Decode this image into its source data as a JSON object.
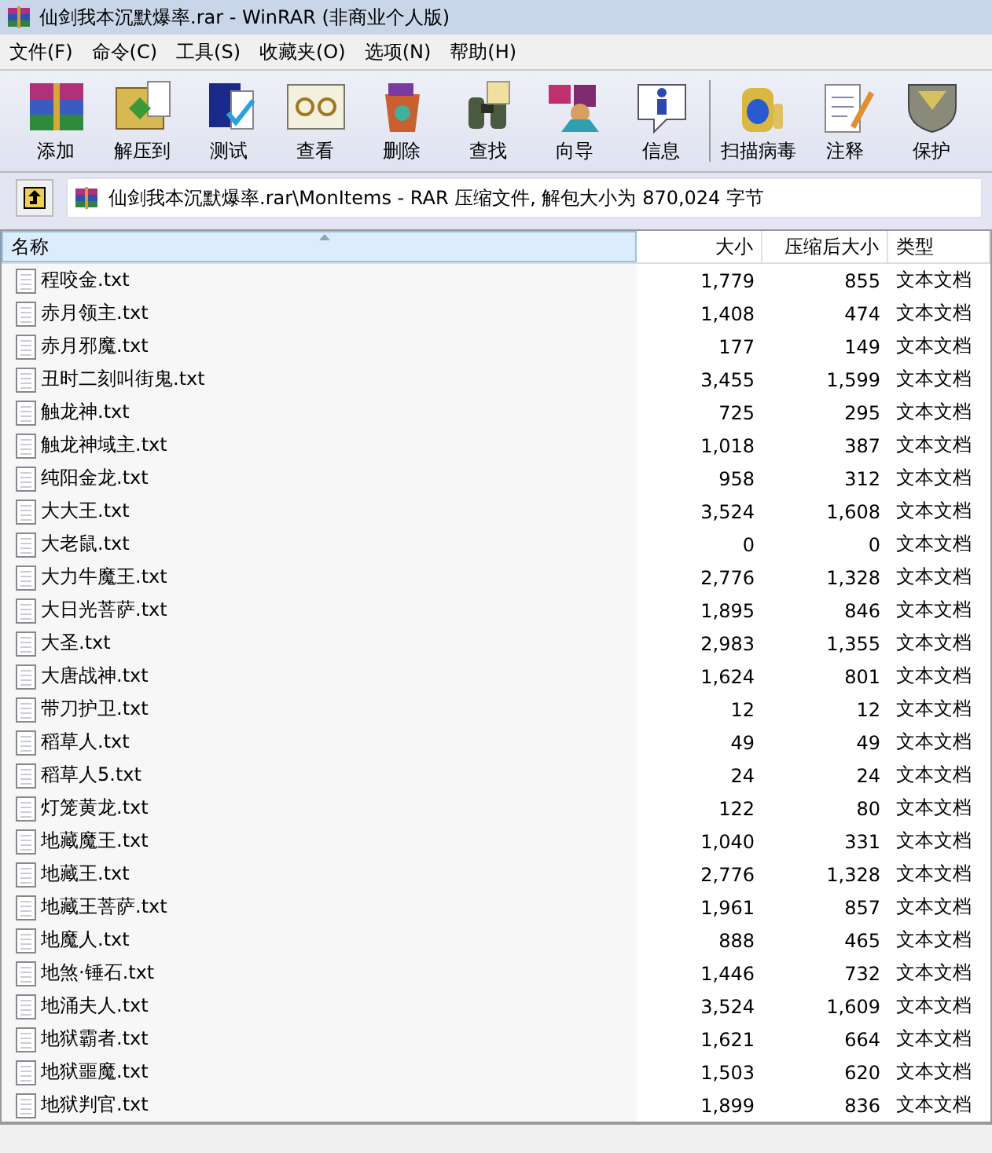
{
  "window": {
    "title": "仙剑我本沉默爆率.rar - WinRAR (非商业个人版)"
  },
  "menu": [
    "文件(F)",
    "命令(C)",
    "工具(S)",
    "收藏夹(O)",
    "选项(N)",
    "帮助(H)"
  ],
  "toolbar": [
    {
      "label": "添加",
      "separator_before": false
    },
    {
      "label": "解压到",
      "separator_before": false
    },
    {
      "label": "测试",
      "separator_before": false
    },
    {
      "label": "查看",
      "separator_before": false
    },
    {
      "label": "删除",
      "separator_before": false
    },
    {
      "label": "查找",
      "separator_before": false
    },
    {
      "label": "向导",
      "separator_before": false
    },
    {
      "label": "信息",
      "separator_before": false
    },
    {
      "label": "扫描病毒",
      "separator_before": true
    },
    {
      "label": "注释",
      "separator_before": false
    },
    {
      "label": "保护",
      "separator_before": false
    }
  ],
  "address": "仙剑我本沉默爆率.rar\\MonItems - RAR 压缩文件, 解包大小为 870,024 字节",
  "table": {
    "columns": [
      {
        "label": "名称",
        "sorted": true
      },
      {
        "label": "大小",
        "sorted": false
      },
      {
        "label": "压缩后大小",
        "sorted": false
      },
      {
        "label": "类型",
        "sorted": false
      }
    ],
    "rows": [
      [
        "程咬金.txt",
        "1,779",
        "855",
        "文本文档"
      ],
      [
        "赤月领主.txt",
        "1,408",
        "474",
        "文本文档"
      ],
      [
        "赤月邪魔.txt",
        "177",
        "149",
        "文本文档"
      ],
      [
        "丑时二刻叫街鬼.txt",
        "3,455",
        "1,599",
        "文本文档"
      ],
      [
        "触龙神.txt",
        "725",
        "295",
        "文本文档"
      ],
      [
        "触龙神域主.txt",
        "1,018",
        "387",
        "文本文档"
      ],
      [
        "纯阳金龙.txt",
        "958",
        "312",
        "文本文档"
      ],
      [
        "大大王.txt",
        "3,524",
        "1,608",
        "文本文档"
      ],
      [
        "大老鼠.txt",
        "0",
        "0",
        "文本文档"
      ],
      [
        "大力牛魔王.txt",
        "2,776",
        "1,328",
        "文本文档"
      ],
      [
        "大日光菩萨.txt",
        "1,895",
        "846",
        "文本文档"
      ],
      [
        "大圣.txt",
        "2,983",
        "1,355",
        "文本文档"
      ],
      [
        "大唐战神.txt",
        "1,624",
        "801",
        "文本文档"
      ],
      [
        "带刀护卫.txt",
        "12",
        "12",
        "文本文档"
      ],
      [
        "稻草人.txt",
        "49",
        "49",
        "文本文档"
      ],
      [
        "稻草人5.txt",
        "24",
        "24",
        "文本文档"
      ],
      [
        "灯笼黄龙.txt",
        "122",
        "80",
        "文本文档"
      ],
      [
        "地藏魔王.txt",
        "1,040",
        "331",
        "文本文档"
      ],
      [
        "地藏王.txt",
        "2,776",
        "1,328",
        "文本文档"
      ],
      [
        "地藏王菩萨.txt",
        "1,961",
        "857",
        "文本文档"
      ],
      [
        "地魔人.txt",
        "888",
        "465",
        "文本文档"
      ],
      [
        "地煞·锤石.txt",
        "1,446",
        "732",
        "文本文档"
      ],
      [
        "地涌夫人.txt",
        "3,524",
        "1,609",
        "文本文档"
      ],
      [
        "地狱霸者.txt",
        "1,621",
        "664",
        "文本文档"
      ],
      [
        "地狱噩魔.txt",
        "1,503",
        "620",
        "文本文档"
      ],
      [
        "地狱判官.txt",
        "1,899",
        "836",
        "文本文档"
      ]
    ]
  }
}
